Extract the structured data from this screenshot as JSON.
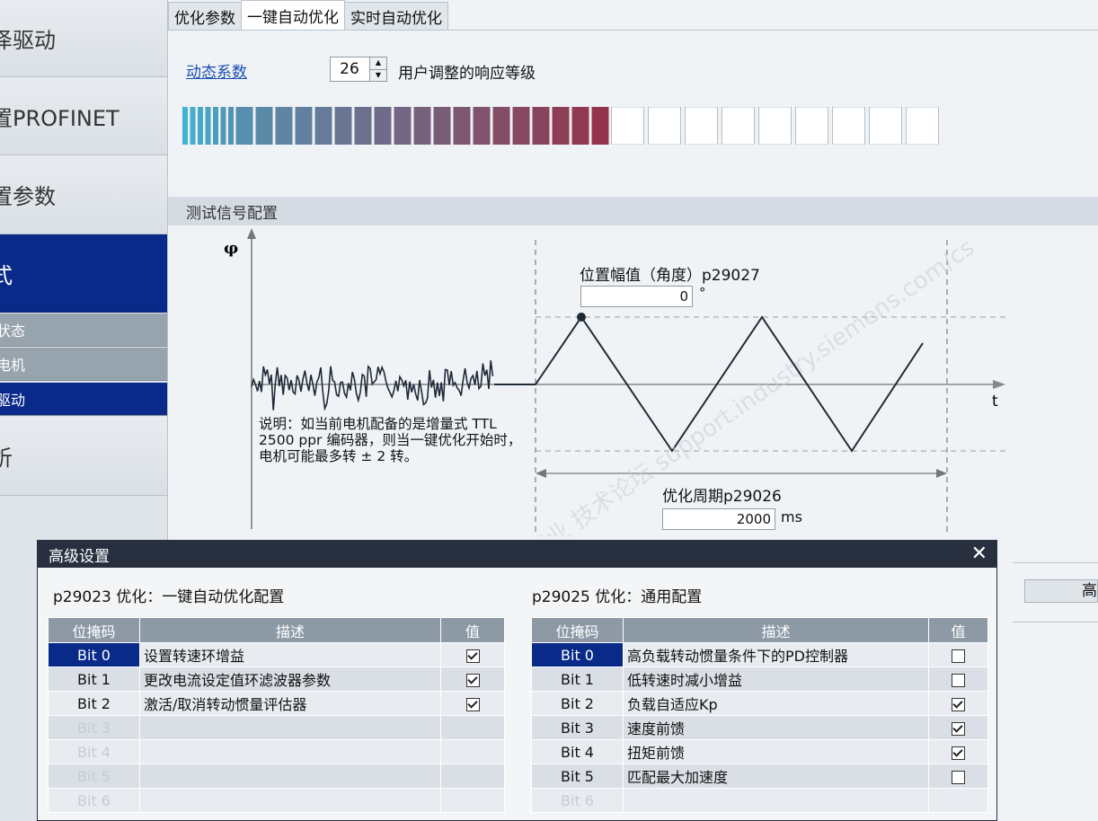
{
  "sidebar": {
    "items": [
      {
        "label": "泽驱动"
      },
      {
        "label": "置PROFINET"
      },
      {
        "label": "置参数"
      },
      {
        "label": "式"
      },
      {
        "label": "状态"
      },
      {
        "label": "电机"
      },
      {
        "label": "驱动"
      },
      {
        "label": "析"
      }
    ]
  },
  "tabs": [
    {
      "label": "优化参数"
    },
    {
      "label": "一键自动优化"
    },
    {
      "label": "实时自动优化"
    }
  ],
  "dynamic": {
    "link": "动态系数",
    "value": "26",
    "description": "用户调整的响应等级",
    "level": 26,
    "total_segments": 35
  },
  "test_signal": {
    "header": "测试信号配置",
    "phi_label": "φ",
    "t_label": "t",
    "amplitude_label": "位置幅值（角度）p29027",
    "amplitude_value": "0",
    "amplitude_unit": "°",
    "note": "说明：如当前电机配备的是增量式 TTL 2500 ppr 编码器，则当一键优化开始时，电机可能最多转 ± 2 转。",
    "period_label": "优化周期p29026",
    "period_value": "2000",
    "period_unit": "ms",
    "watermark": "西门子工业 技术论坛 support.industry.siemens.com/cs"
  },
  "right_button": {
    "label": "高"
  },
  "dialog": {
    "title": "高级设置",
    "close": "✕",
    "left": {
      "caption": "p29023 优化：一键自动优化配置",
      "headers": [
        "位掩码",
        "描述",
        "值"
      ],
      "rows": [
        {
          "bit": "Bit 0",
          "desc": "设置转速环增益",
          "checked": true
        },
        {
          "bit": "Bit 1",
          "desc": "更改电流设定值环滤波器参数",
          "checked": true
        },
        {
          "bit": "Bit 2",
          "desc": "激活/取消转动惯量评估器",
          "checked": true
        },
        {
          "bit": "Bit 3",
          "desc": "",
          "checked": null
        },
        {
          "bit": "Bit 4",
          "desc": "",
          "checked": null
        },
        {
          "bit": "Bit 5",
          "desc": "",
          "checked": null
        },
        {
          "bit": "Bit 6",
          "desc": "",
          "checked": null
        }
      ]
    },
    "right": {
      "caption": "p29025 优化：通用配置",
      "headers": [
        "位掩码",
        "描述",
        "值"
      ],
      "rows": [
        {
          "bit": "Bit 0",
          "desc": "高负载转动惯量条件下的PD控制器",
          "checked": false
        },
        {
          "bit": "Bit 1",
          "desc": "低转速时减小增益",
          "checked": false
        },
        {
          "bit": "Bit 2",
          "desc": "负载自适应Kp",
          "checked": true
        },
        {
          "bit": "Bit 3",
          "desc": "速度前馈",
          "checked": true
        },
        {
          "bit": "Bit 4",
          "desc": "扭矩前馈",
          "checked": true
        },
        {
          "bit": "Bit 5",
          "desc": "匹配最大加速度",
          "checked": false
        },
        {
          "bit": "Bit 6",
          "desc": "",
          "checked": null
        }
      ]
    }
  }
}
